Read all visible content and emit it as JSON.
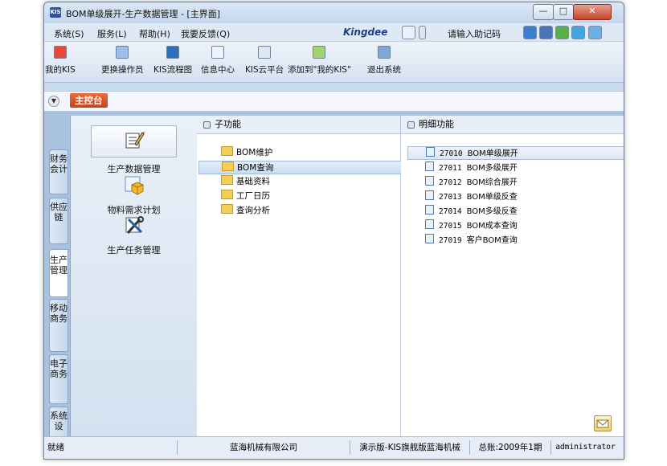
{
  "window": {
    "title": "BOM单级展开-生产数据管理 - [主界面]",
    "logo_text": "KIS"
  },
  "menubar": {
    "items": [
      "系统(S)",
      "服务(L)",
      "帮助(H)",
      "我要反馈(Q)"
    ],
    "brand": "Kingdee",
    "help_code_placeholder": "请输入助记码"
  },
  "toolbar": {
    "buttons": [
      "我的KIS",
      "更换操作员",
      "KIS流程图",
      "信息中心",
      "KIS云平台",
      "添加到\"我的KIS\"",
      "退出系统"
    ]
  },
  "tabs": {
    "main": "主控台"
  },
  "sidetabs": [
    "财务会计",
    "供应链",
    "生产管理",
    "移动商务",
    "电子商务",
    "系统设"
  ],
  "sidetabs_active": "生产管理",
  "nav": {
    "items": [
      "生产数据管理",
      "物料需求计划",
      "生产任务管理"
    ],
    "selected": "生产数据管理"
  },
  "sub_functions": {
    "header": "子功能",
    "items": [
      "BOM维护",
      "BOM查询",
      "基础资料",
      "工厂日历",
      "查询分析"
    ],
    "selected": "BOM查询"
  },
  "detail_functions": {
    "header": "明细功能",
    "items": [
      {
        "code": "27010",
        "name": "BOM单级展开"
      },
      {
        "code": "27011",
        "name": "BOM多级展开"
      },
      {
        "code": "27012",
        "name": "BOM综合展开"
      },
      {
        "code": "27013",
        "name": "BOM单级反查"
      },
      {
        "code": "27014",
        "name": "BOM多级反查"
      },
      {
        "code": "27015",
        "name": "BOM成本查询"
      },
      {
        "code": "27019",
        "name": "客户BOM查询"
      }
    ],
    "selected": "27010"
  },
  "statusbar": {
    "ready": "就绪",
    "company": "蓝海机械有限公司",
    "edition": "演示版-KIS旗舰版蓝海机械",
    "period": "总账:2009年1期",
    "user": "administrator"
  },
  "colors": {
    "accent_tab": "#d9532a",
    "window_frame": "#c9dbef",
    "close_button": "#c8432a"
  }
}
